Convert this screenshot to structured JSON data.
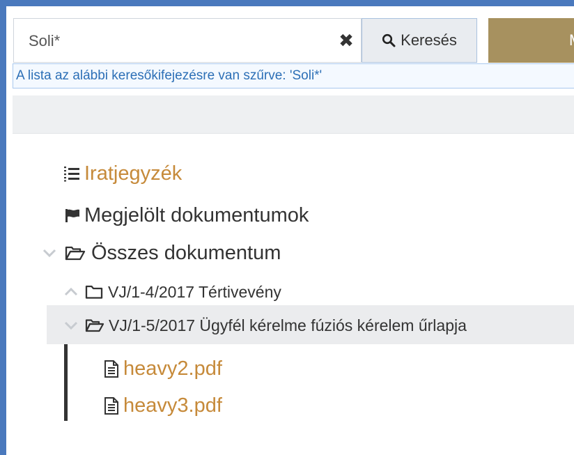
{
  "search": {
    "value": "Soli*",
    "clear_icon": "close-icon",
    "button_label": "Keresés",
    "button_icon": "search-icon",
    "secondary_button_label": "M"
  },
  "filter_notice": "A lista az alábbi keresőkifejezésre van szűrve: 'Soli*'",
  "tree": {
    "register": {
      "label": "Iratjegyzék",
      "icon": "list-icon"
    },
    "flagged": {
      "label": "Megjelölt dokumentumok",
      "icon": "flag-icon"
    },
    "all_docs": {
      "label": "Összes dokumentum",
      "icon": "folder-open-icon",
      "state": "expanded"
    },
    "folder_1": {
      "label": "VJ/1-4/2017 Tértivevény",
      "icon": "folder-icon",
      "state": "collapsed"
    },
    "folder_2": {
      "label": "VJ/1-5/2017 Ügyfél kérelme fúziós kérelem űrlapja",
      "icon": "folder-open-icon",
      "state": "expanded"
    },
    "files": [
      {
        "label": "heavy2.pdf",
        "icon": "file-text-icon"
      },
      {
        "label": "heavy3.pdf",
        "icon": "file-text-icon"
      }
    ]
  },
  "colors": {
    "accent_link": "#c68a3a",
    "frame_border": "#4a79bd",
    "filter_text": "#2c6fb6",
    "secondary_button": "#a7915f"
  }
}
